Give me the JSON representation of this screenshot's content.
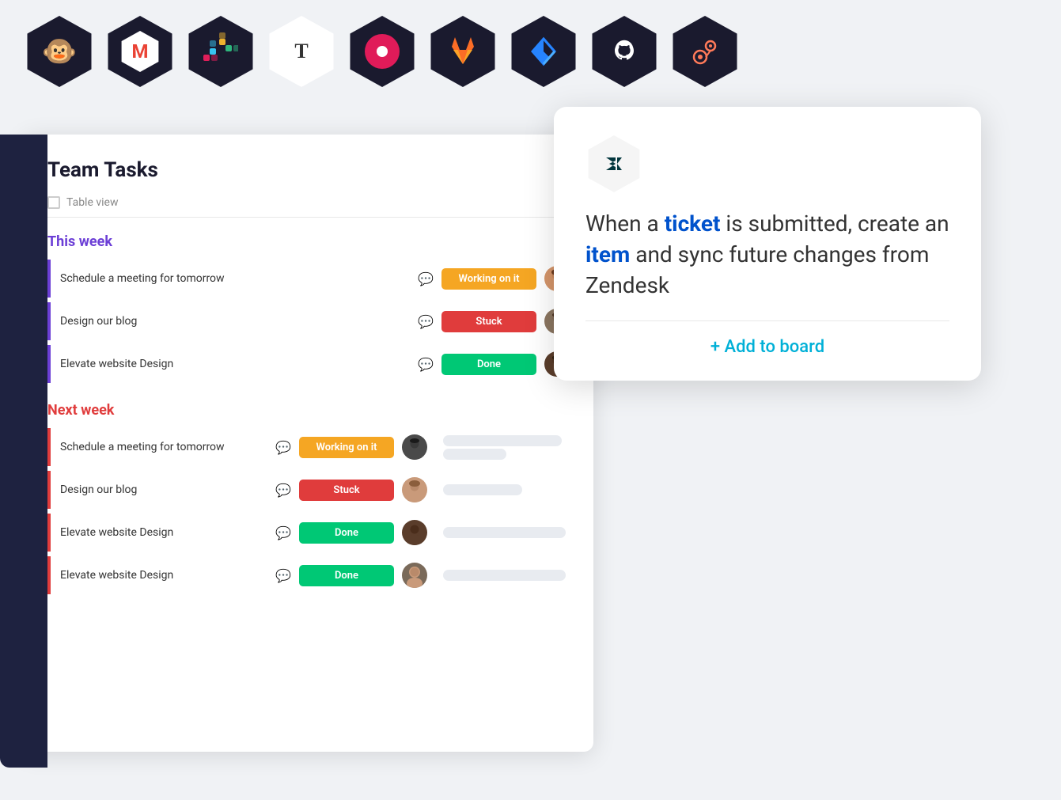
{
  "icons": [
    {
      "name": "mailchimp",
      "symbol": "🐵",
      "dark": true
    },
    {
      "name": "gmail",
      "symbol": "M",
      "dark": true,
      "color": "#EA4335"
    },
    {
      "name": "slack",
      "symbol": "✦",
      "dark": true
    },
    {
      "name": "typeform",
      "symbol": "T",
      "dark": false
    },
    {
      "name": "toggl",
      "symbol": "⬤",
      "dark": true,
      "color": "#E01B59"
    },
    {
      "name": "gitlab",
      "symbol": "🦊",
      "dark": true
    },
    {
      "name": "jira",
      "symbol": "⇦",
      "dark": true,
      "color": "#2684FF"
    },
    {
      "name": "github",
      "symbol": "◉",
      "dark": true
    },
    {
      "name": "hubspot",
      "symbol": "⊕",
      "dark": true,
      "color": "#FF7A59"
    }
  ],
  "board": {
    "title": "Team Tasks",
    "view_label": "Table view",
    "this_week": {
      "label": "This week",
      "tasks": [
        {
          "name": "Schedule a meeting for tomorrow",
          "status": "Working on it",
          "status_type": "working"
        },
        {
          "name": "Design our blog",
          "status": "Stuck",
          "status_type": "stuck"
        },
        {
          "name": "Elevate website Design",
          "status": "Done",
          "status_type": "done"
        }
      ]
    },
    "next_week": {
      "label": "Next week",
      "tasks": [
        {
          "name": "Schedule a meeting for tomorrow",
          "status": "Working on it",
          "status_type": "working"
        },
        {
          "name": "Design our blog",
          "status": "Stuck",
          "status_type": "stuck"
        },
        {
          "name": "Elevate website Design",
          "status": "Done",
          "status_type": "done"
        },
        {
          "name": "Elevate website Design",
          "status": "Done",
          "status_type": "done"
        }
      ]
    }
  },
  "zendesk_card": {
    "description_prefix": "When a ",
    "ticket_word": "ticket",
    "description_mid": " is submitted, create an ",
    "item_word": "item",
    "description_suffix": " and sync future changes from Zendesk",
    "add_to_board": "+ Add to board"
  }
}
